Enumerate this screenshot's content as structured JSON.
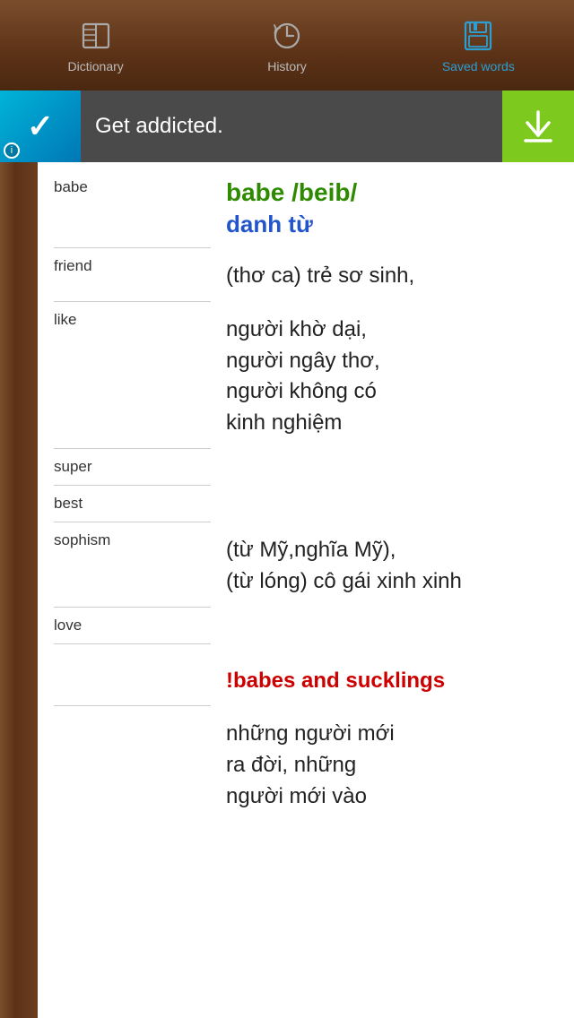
{
  "tabs": [
    {
      "id": "dictionary",
      "label": "Dictionary",
      "active": false,
      "icon": "book"
    },
    {
      "id": "history",
      "label": "History",
      "active": false,
      "icon": "history"
    },
    {
      "id": "saved",
      "label": "Saved words",
      "active": true,
      "icon": "save"
    }
  ],
  "ad": {
    "text": "Get addicted.",
    "info": "i",
    "download_aria": "Download"
  },
  "main_word": {
    "heading": "babe /beib/",
    "word_class": "danh từ",
    "definitions": [
      {
        "left_words": [
          "babe"
        ],
        "texts": [
          "(thơ ca) trẻ sơ sinh,"
        ]
      },
      {
        "left_words": [
          "friend"
        ],
        "texts": []
      },
      {
        "left_words": [
          "like"
        ],
        "texts": [
          "người khờ dại,",
          "người ngây thơ,",
          "người không có",
          "kinh nghiệm"
        ]
      },
      {
        "left_words": [
          "super"
        ],
        "texts": []
      },
      {
        "left_words": [
          "best"
        ],
        "texts": []
      },
      {
        "left_words": [
          "sophism"
        ],
        "texts": [
          "(từ Mỹ,nghĩa Mỹ),",
          "(từ lóng) cô gái xinh",
          "xinh"
        ]
      },
      {
        "left_words": [
          "love"
        ],
        "texts": []
      },
      {
        "left_words": [],
        "phrase": "!babes and sucklings",
        "phrase_color": "red"
      },
      {
        "left_words": [],
        "texts": [
          "những người mới",
          "ra đời, những",
          "người mới vào"
        ]
      }
    ]
  }
}
